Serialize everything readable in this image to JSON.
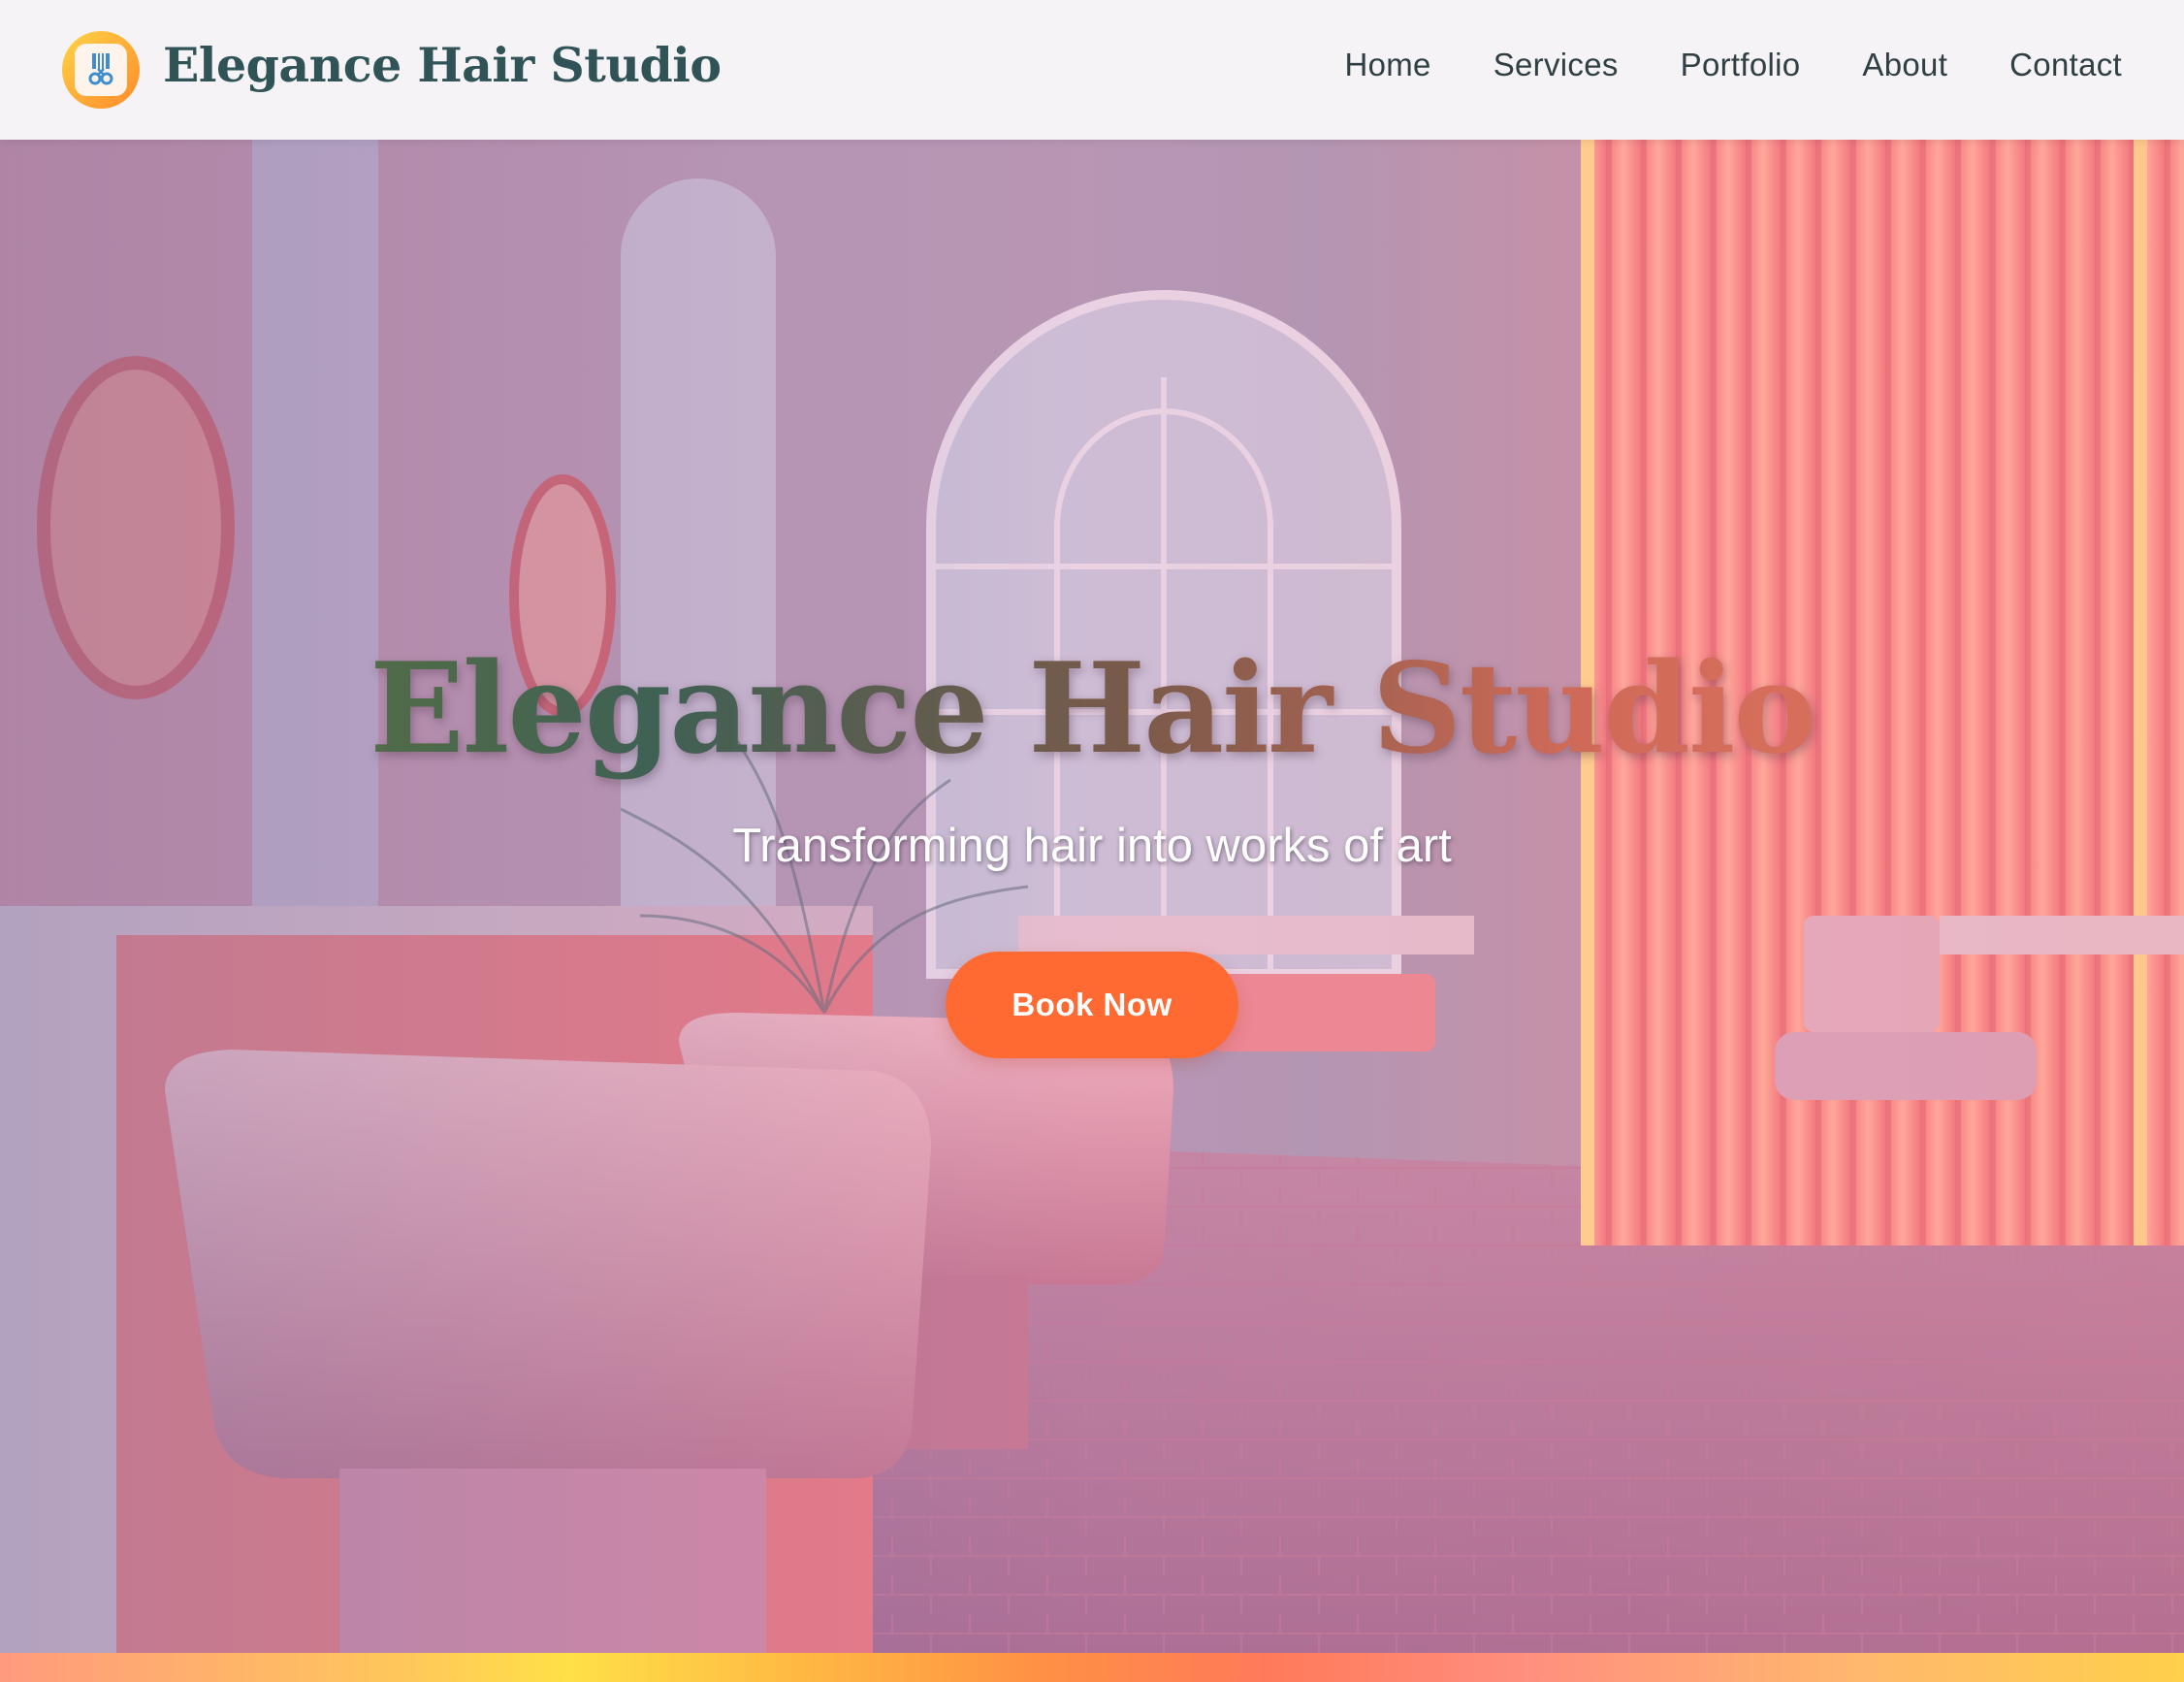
{
  "header": {
    "brand": "Elegance Hair Studio",
    "logo_icon": "scissors-comb-icon",
    "nav": [
      {
        "label": "Home"
      },
      {
        "label": "Services"
      },
      {
        "label": "Portfolio"
      },
      {
        "label": "About"
      },
      {
        "label": "Contact"
      }
    ]
  },
  "hero": {
    "title": "Elegance Hair Studio",
    "subtitle": "Transforming hair into works of art",
    "cta_label": "Book Now",
    "background_image": "pink salon interior with wash chairs, arched windows, round mirrors and neon vertical slats"
  },
  "colors": {
    "brand_text": "#2f5356",
    "cta": "#ff6a33",
    "accent_yellow": "#ffd447",
    "accent_orange": "#ff8a2a"
  }
}
